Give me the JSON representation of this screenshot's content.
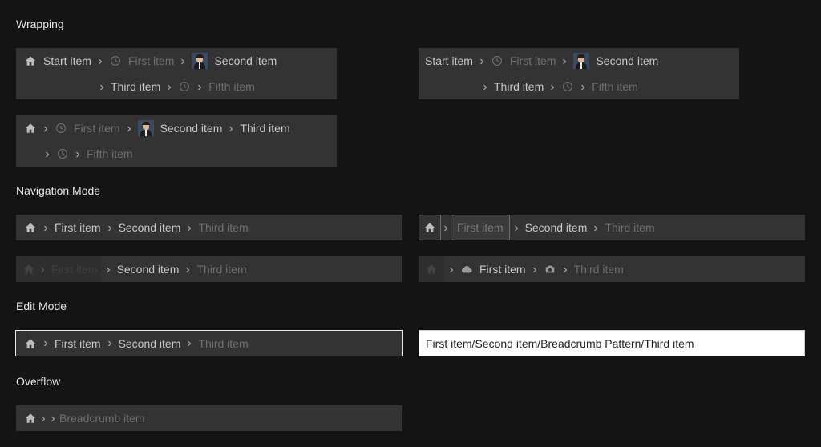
{
  "sections": {
    "wrapping": "Wrapping",
    "navigation": "Navigation Mode",
    "edit": "Edit Mode",
    "overflow": "Overflow"
  },
  "wrap1": {
    "start": "Start item",
    "first": "First item",
    "second": "Second item",
    "third": "Third item",
    "fifth": "Fifth item"
  },
  "wrap2": {
    "start": "Start item",
    "first": "First item",
    "second": "Second item",
    "third": "Third item",
    "fifth": "Fifth item"
  },
  "wrap3": {
    "first": "First item",
    "second": "Second item",
    "third": "Third item",
    "fifth": "Fifth item"
  },
  "nav1": {
    "first": "First item",
    "second": "Second item",
    "third": "Third item"
  },
  "nav2": {
    "first": "First item",
    "second": "Second item",
    "third": "Third item"
  },
  "nav3": {
    "first": "First item",
    "second": "Second item",
    "third": "Third item"
  },
  "nav4": {
    "first": "First item",
    "third": "Third item"
  },
  "edit1": {
    "first": "First item",
    "second": "Second item",
    "third": "Third item"
  },
  "edit2": {
    "value": "First item/Second item/Breadcrumb Pattern/Third item"
  },
  "overflow": {
    "item": "Breadcrumb item"
  },
  "icons": {
    "home": "home-icon",
    "clock": "clock-icon",
    "cloud": "cloud-icon",
    "camera": "camera-icon",
    "avatar": "avatar",
    "separator": "chevron-right-icon"
  }
}
